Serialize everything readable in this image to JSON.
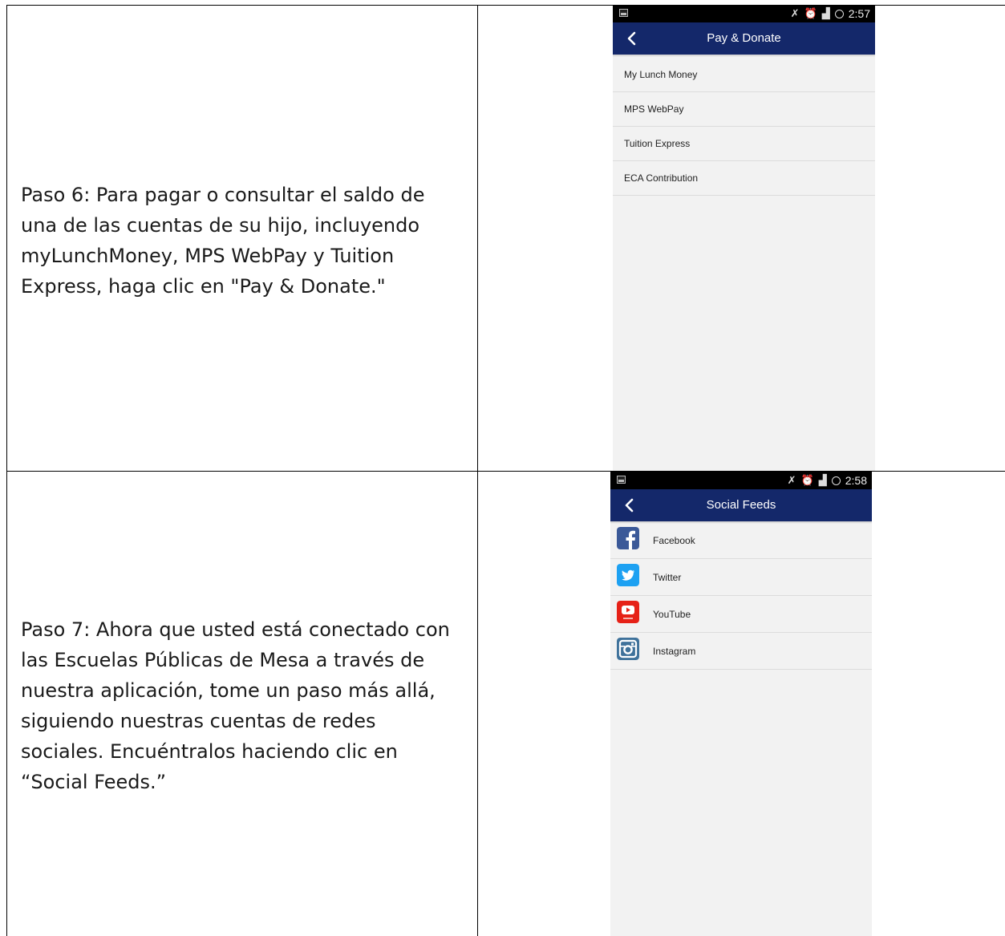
{
  "steps": [
    {
      "text": "Paso 6: Para pagar o consultar el saldo de\nuna de las cuentas de su hijo, incluyendo\nmyLunchMoney, MPS WebPay y Tuition\nExpress, haga clic en \"Pay & Donate.\"",
      "phone": {
        "status_time": "2:57",
        "title": "Pay & Donate",
        "items": [
          "My Lunch Money",
          "MPS WebPay",
          "Tuition Express",
          "ECA Contribution"
        ]
      }
    },
    {
      "text": "Paso 7: Ahora que usted está conectado con\nlas Escuelas Públicas de Mesa a través de\nnuestra aplicación, tome un paso más allá,\nsiguiendo nuestras cuentas de redes\nsociales. Encuéntralos haciendo clic en\n“Social Feeds.”",
      "phone": {
        "status_time": "2:58",
        "title": "Social Feeds",
        "items": [
          {
            "label": "Facebook",
            "icon": "facebook-icon",
            "color": "#3b5998"
          },
          {
            "label": "Twitter",
            "icon": "twitter-icon",
            "color": "#1da1f2"
          },
          {
            "label": "YouTube",
            "icon": "youtube-icon",
            "color": "#e62117"
          },
          {
            "label": "Instagram",
            "icon": "instagram-icon",
            "color": "#3f729b"
          }
        ]
      }
    }
  ],
  "colors": {
    "appbar": "#14286a",
    "status_bar": "#000000",
    "screen_bg": "#f2f2f2"
  }
}
